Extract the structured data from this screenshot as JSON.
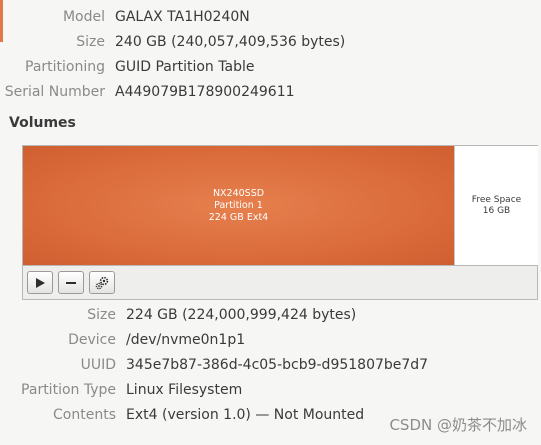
{
  "disk": {
    "model_label": "Model",
    "model_value": "GALAX TA1H0240N",
    "size_label": "Size",
    "size_value": "240 GB (240,057,409,536 bytes)",
    "partitioning_label": "Partitioning",
    "partitioning_value": "GUID Partition Table",
    "serial_label": "Serial Number",
    "serial_value": "A449079B178900249611"
  },
  "volumes": {
    "title": "Volumes",
    "partition": {
      "name": "NX240SSD",
      "number": "Partition 1",
      "size_fs": "224 GB Ext4",
      "color": "#d96838"
    },
    "free_space": {
      "label": "Free Space",
      "size": "16 GB"
    },
    "toolbar": {
      "play_icon": "play-icon",
      "remove_icon": "minus-icon",
      "settings_icon": "gears-icon"
    }
  },
  "selected_volume": {
    "size_label": "Size",
    "size_value": "224 GB (224,000,999,424 bytes)",
    "device_label": "Device",
    "device_value": "/dev/nvme0n1p1",
    "uuid_label": "UUID",
    "uuid_value": "345e7b87-386d-4c05-bcb9-d951807be7d7",
    "partition_type_label": "Partition Type",
    "partition_type_value": "Linux Filesystem",
    "contents_label": "Contents",
    "contents_value": "Ext4 (version 1.0) — Not Mounted"
  },
  "watermark": "CSDN @奶茶不加冰"
}
